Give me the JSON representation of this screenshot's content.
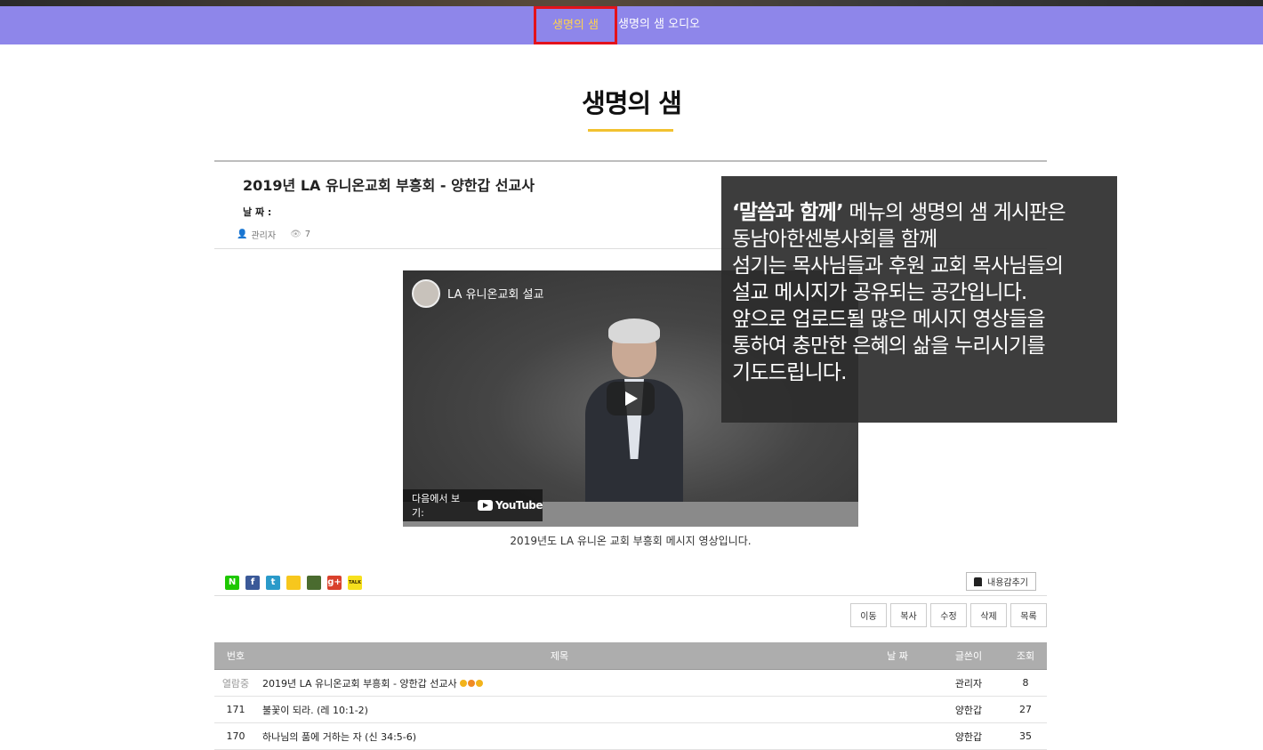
{
  "subnav": {
    "tabs": [
      {
        "label": "생명의 샘",
        "active": true
      },
      {
        "label": "생명의 샘 오디오",
        "active": false
      }
    ]
  },
  "page": {
    "title": "생명의 샘"
  },
  "post": {
    "title": "2019년 LA 유니온교회 부흥회 - 양한갑 선교사",
    "date_label": "날 짜 :",
    "author": "관리자",
    "views": "7",
    "caption": "2019년도 LA 유니온 교회 부흥회 메시지 영상입니다."
  },
  "video": {
    "channel_title": "LA 유니온교회 설교",
    "watch_on": "다음에서 보기:",
    "youtube_label": "YouTube"
  },
  "overlay": {
    "bold_text": "‘말씀과 함께’",
    "lines": [
      " 메뉴의 생명의 샘 게시판은",
      "동남아한센봉사회를 함께",
      "섬기는 목사님들과 후원 교회 목사님들의",
      "설교 메시지가 공유되는 공간입니다.",
      "앞으로 업로드될 많은 메시지 영상들을",
      "통하여 충만한 은혜의 삶을 누리시기를",
      "기도드립니다."
    ]
  },
  "share": {
    "icons": [
      {
        "name": "naver-icon",
        "glyph": "N",
        "color": "#1ec800"
      },
      {
        "name": "facebook-icon",
        "glyph": "f",
        "color": "#3b5998"
      },
      {
        "name": "twitter-icon",
        "glyph": "t",
        "color": "#2a9ac9"
      },
      {
        "name": "kakaostory-icon",
        "glyph": "",
        "color": "#f7c71d"
      },
      {
        "name": "band-icon",
        "glyph": "",
        "color": "#4a6b2f"
      },
      {
        "name": "googleplus-icon",
        "glyph": "g+",
        "color": "#d9412c"
      },
      {
        "name": "kakaotalk-icon",
        "glyph": "TALK",
        "color": "#f7e01d"
      }
    ],
    "hide_content_label": "내용감추기"
  },
  "actions": [
    "이동",
    "복사",
    "수정",
    "삭제",
    "목록"
  ],
  "list": {
    "headers": {
      "num": "번호",
      "title": "제목",
      "date": "날 짜",
      "author": "글쓴이",
      "views": "조회"
    },
    "rows": [
      {
        "num": "열람중",
        "title": "2019년 LA 유니온교회 부흥회 - 양한갑 선교사",
        "author": "관리자",
        "views": "8",
        "reading": true
      },
      {
        "num": "171",
        "title": "불꽃이 되라. (레 10:1-2)",
        "author": "양한갑",
        "views": "27",
        "reading": false
      },
      {
        "num": "170",
        "title": "하나님의 품에 거하는 자 (신 34:5-6)",
        "author": "양한갑",
        "views": "35",
        "reading": false
      }
    ]
  }
}
